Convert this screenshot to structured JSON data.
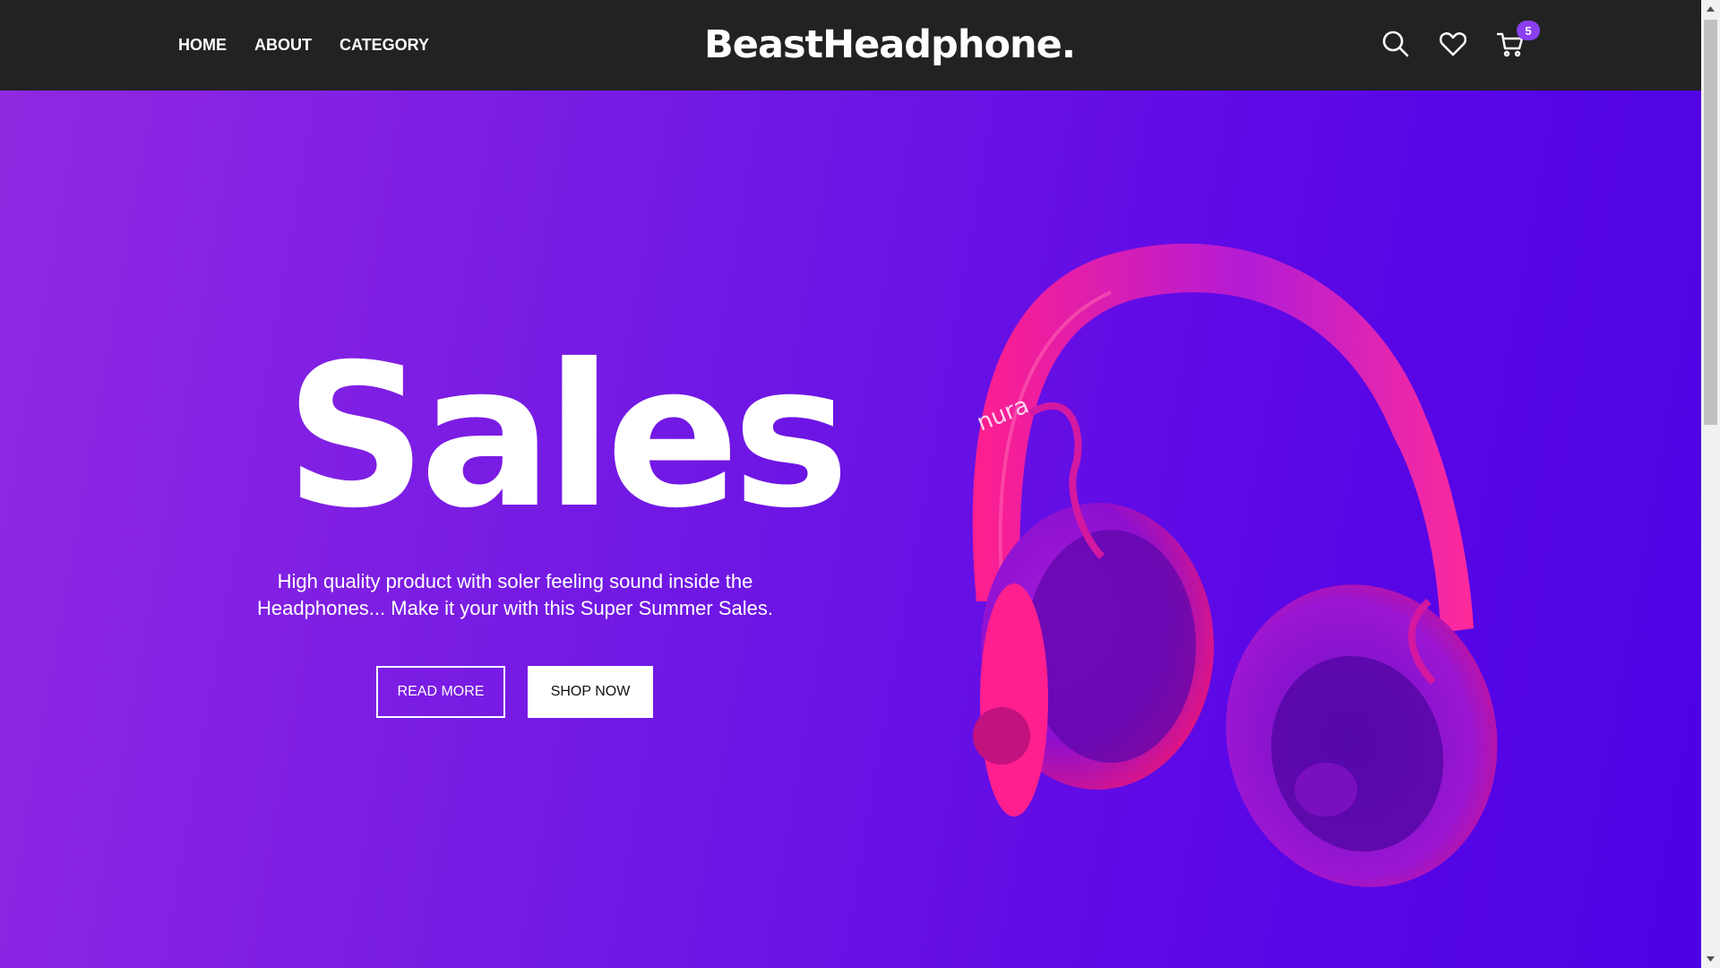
{
  "nav": {
    "items": [
      {
        "label": "HOME"
      },
      {
        "label": "ABOUT"
      },
      {
        "label": "CATEGORY"
      }
    ]
  },
  "logo": "BeastHeadphone.",
  "header_icons": {
    "search": "search-icon",
    "wishlist": "heart-icon",
    "cart": "cart-icon",
    "cart_count": "5"
  },
  "hero": {
    "title": "Sales",
    "text": "High quality product with soler feeling sound inside the Headphones... Make it your with this Super Summer Sales.",
    "read_more": "READ MORE",
    "shop_now": "SHOP NOW",
    "product_brand": "nura"
  },
  "colors": {
    "header_bg": "#222222",
    "hero_gradient_start": "#9128e2",
    "hero_gradient_end": "#4d02e4",
    "badge": "#8a3ff0",
    "headphone_pink": "#ff1f8e",
    "headphone_purple": "#7a10e0"
  }
}
